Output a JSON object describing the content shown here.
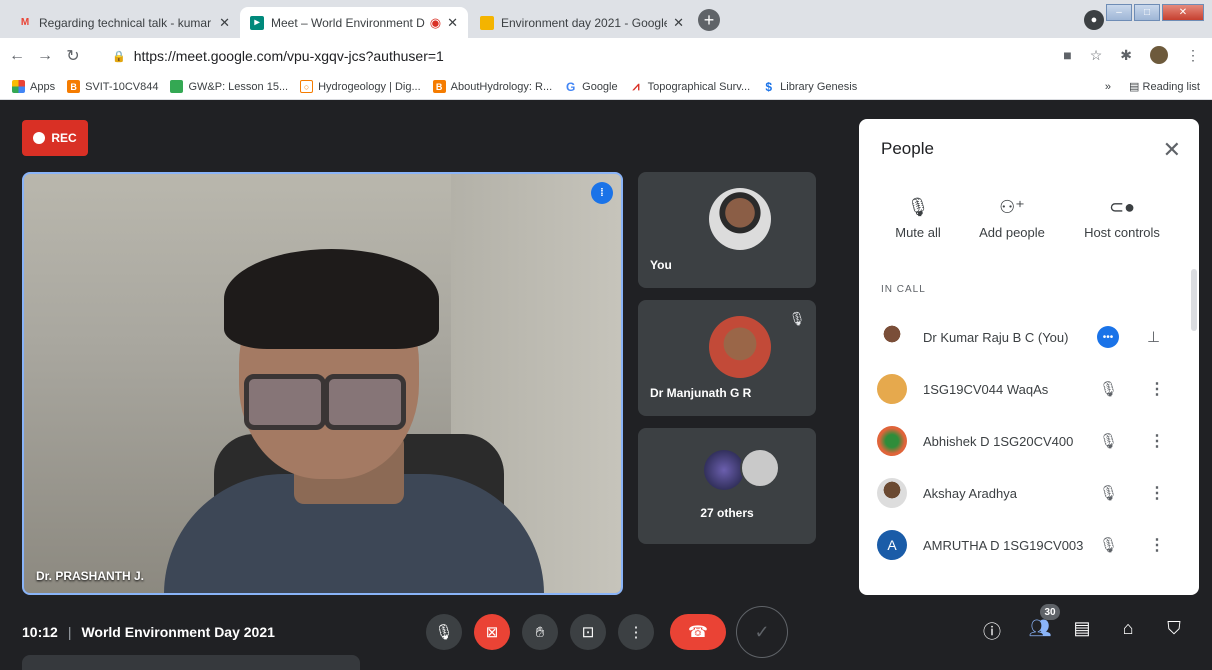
{
  "tabs": [
    {
      "title": "Regarding technical talk - kumar",
      "favicon": "M"
    },
    {
      "title": "Meet – World Environment D",
      "favicon": "meet"
    },
    {
      "title": "Environment day 2021 - Google S",
      "favicon": "slides"
    }
  ],
  "new_tab": "+",
  "url": "https://meet.google.com/vpu-xgqv-jcs?authuser=1",
  "bookmarks": [
    {
      "label": "Apps",
      "color": "#ea4335"
    },
    {
      "label": "SVIT-10CV844",
      "color": "#f57c00"
    },
    {
      "label": "GW&P: Lesson 15...",
      "color": "#34a853"
    },
    {
      "label": "Hydrogeology | Dig...",
      "color": "#fbbc04"
    },
    {
      "label": "AboutHydrology: R...",
      "color": "#f57c00"
    },
    {
      "label": "Google",
      "color": "#4285f4"
    },
    {
      "label": "Topographical Surv...",
      "color": "#d93025"
    },
    {
      "label": "Library Genesis",
      "color": "#1a73e8"
    }
  ],
  "bookmarks_more": "»",
  "reading_list": "Reading list",
  "rec_label": "REC",
  "main_speaker": "Dr. PRASHANTH J.",
  "side_tiles": {
    "you": "You",
    "second": "Dr Manjunath G R",
    "others": "27 others"
  },
  "people_panel": {
    "title": "People",
    "actions": [
      "Mute all",
      "Add people",
      "Host controls"
    ],
    "section": "IN CALL",
    "people": [
      {
        "name": "Dr Kumar Raju B C (You)",
        "type": "self"
      },
      {
        "name": "1SG19CV044 WaqAs",
        "type": "muted"
      },
      {
        "name": "Abhishek D 1SG20CV400",
        "type": "muted"
      },
      {
        "name": "Akshay Aradhya",
        "type": "muted"
      },
      {
        "name": "AMRUTHA D 1SG19CV003",
        "type": "muted",
        "initial": "A"
      }
    ]
  },
  "meeting": {
    "time": "10:12",
    "separator": "|",
    "name": "World Environment Day 2021"
  },
  "participant_count": "30",
  "colors": {
    "accent": "#1a73e8",
    "danger": "#ea4335",
    "background": "#202124",
    "tile": "#3c4043"
  }
}
